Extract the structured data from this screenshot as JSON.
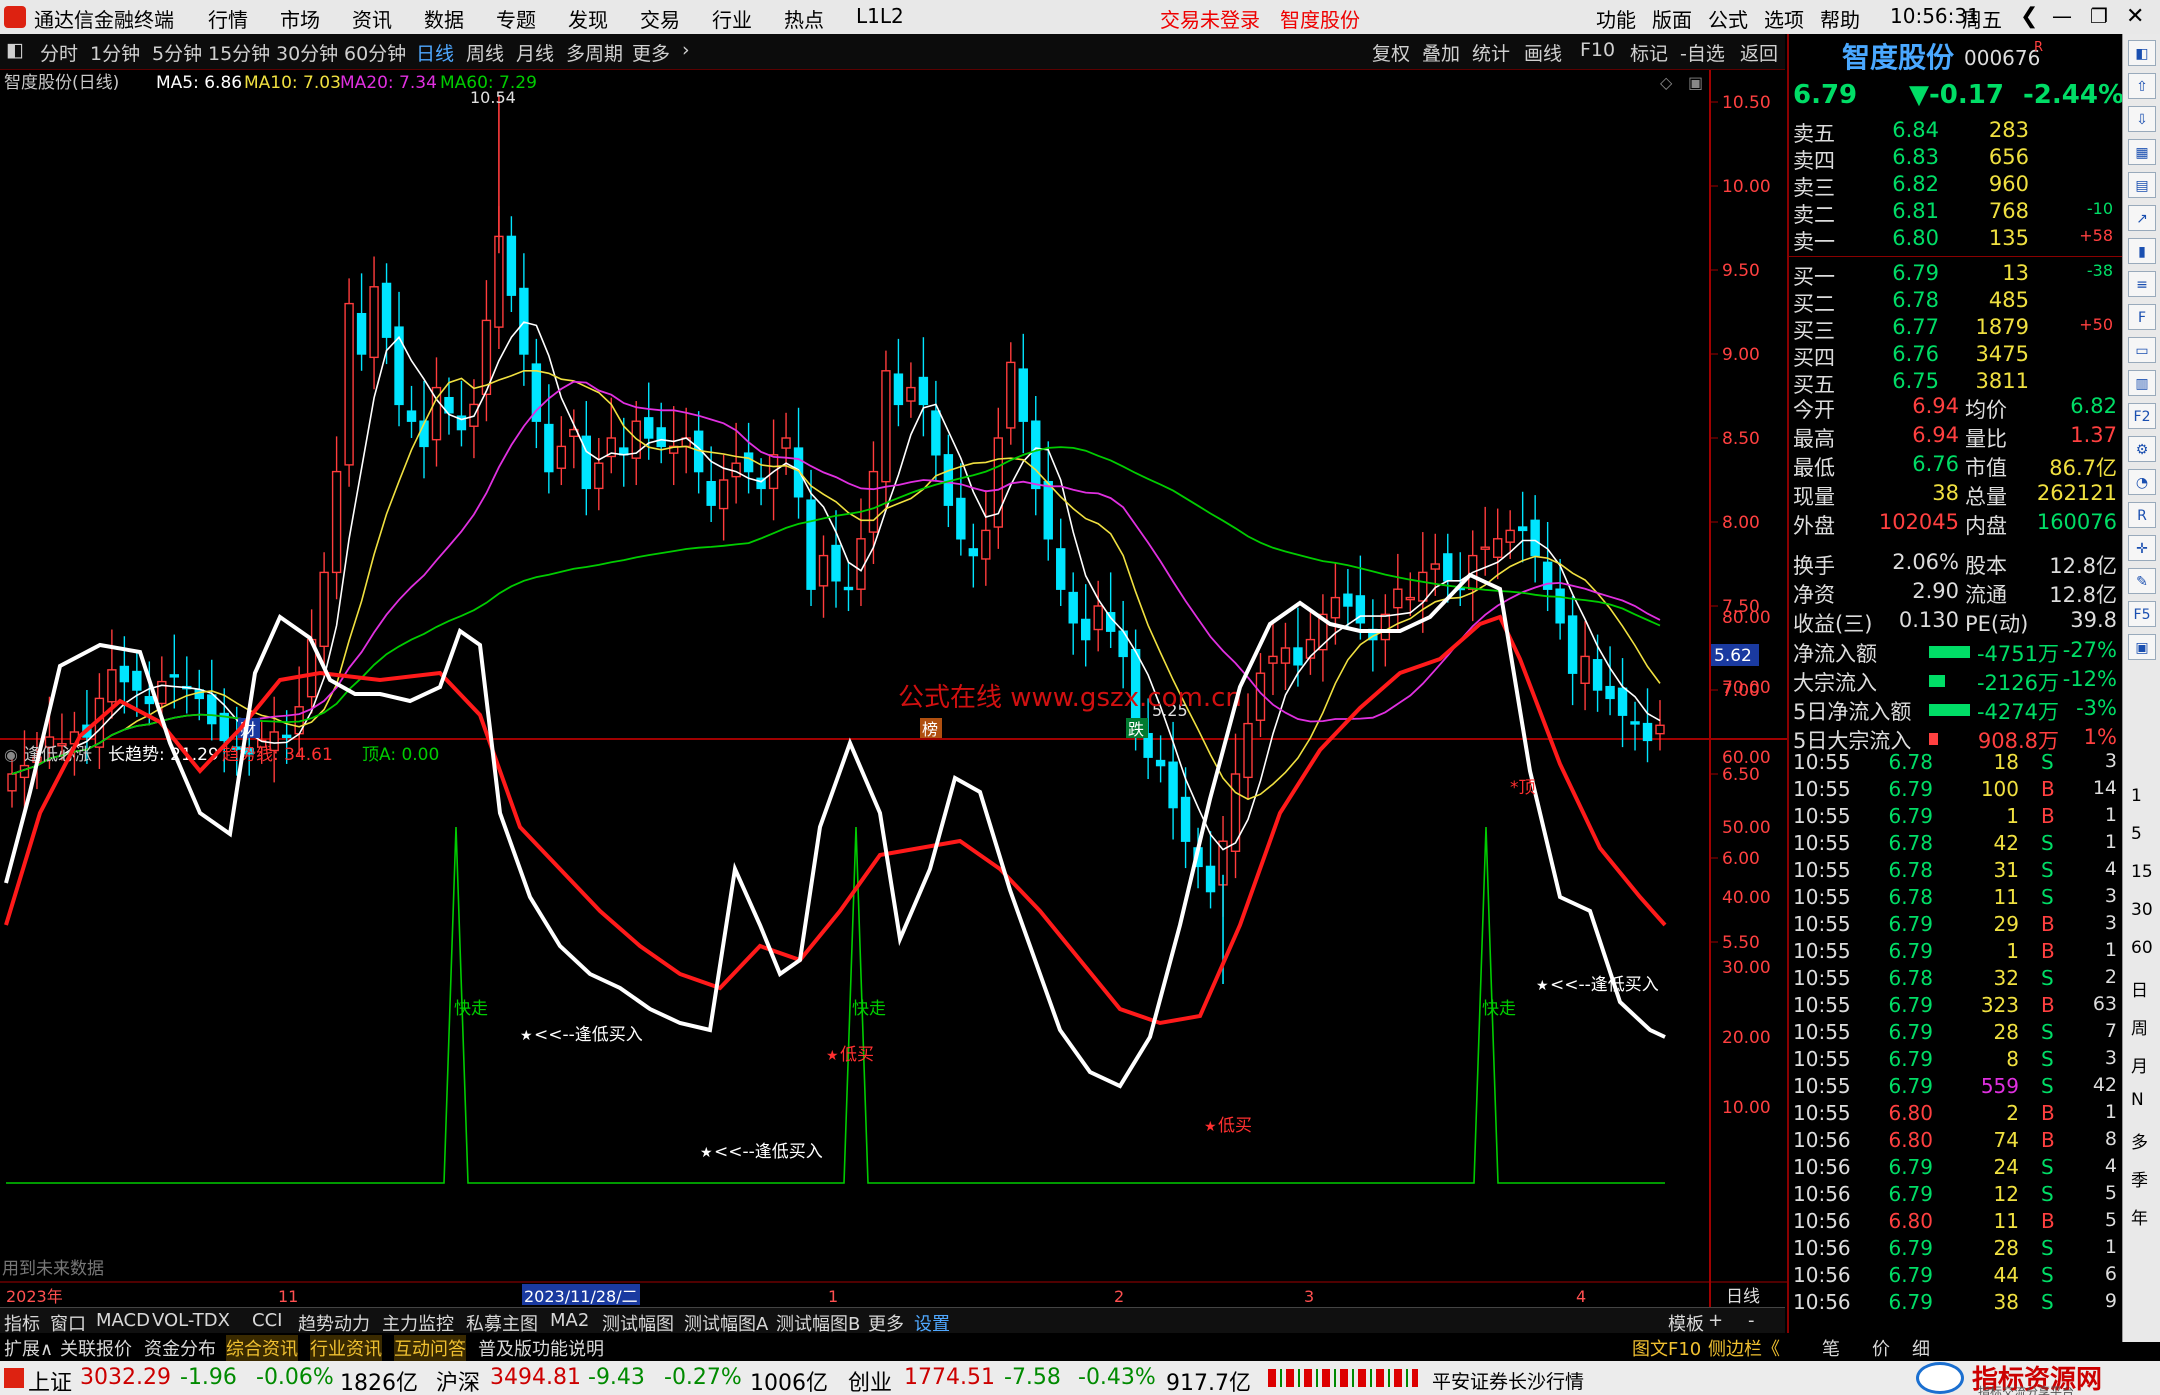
{
  "menubar": {
    "app_title": "通达信金融终端",
    "menus": [
      "行情",
      "市场",
      "资讯",
      "数据",
      "专题",
      "发现",
      "交易",
      "行业",
      "热点",
      "L1L2"
    ],
    "login": "交易未登录",
    "stock_name_top": "智度股份",
    "right_menus": [
      "功能",
      "版面",
      "公式",
      "选项",
      "帮助"
    ],
    "time": "10:56:31",
    "weekday": "周五"
  },
  "toolbar": {
    "periods": [
      "分时",
      "1分钟",
      "5分钟",
      "15分钟",
      "30分钟",
      "60分钟",
      "日线",
      "周线",
      "月线",
      "多周期",
      "更多"
    ],
    "actions": [
      "复权",
      "叠加",
      "统计",
      "画线",
      "F10",
      "标记",
      "-自选",
      "返回"
    ]
  },
  "main_chart": {
    "title": "智度股份(日线)",
    "ma5": "MA5: 6.86",
    "ma10": "MA10: 7.03",
    "ma20": "MA20: 7.34",
    "ma60": "MA60: 7.29",
    "high_label": "10.54",
    "low_label": "5.25",
    "watermark": "公式在线 www.gszx.com.cn",
    "cursor_price": "5.62",
    "y_ticks": [
      "10.50",
      "10.00",
      "9.50",
      "9.00",
      "8.50",
      "8.00",
      "7.50",
      "7.00",
      "6.50",
      "6.00",
      "5.50"
    ],
    "markers": [
      "财",
      "榜",
      "跌"
    ],
    "colors": {
      "up": "#ff3c3c",
      "down": "#00e5ff",
      "ma5": "#ffffff",
      "ma10": "#f0e040",
      "ma20": "#e030e0",
      "ma60": "#00cc00"
    }
  },
  "indicator": {
    "title": "逢低必涨",
    "long_trend": "长趋势: 21.29",
    "trend_line": "趋势线: 34.61",
    "top_a": "顶A: 0.00",
    "y_ticks": [
      "80.00",
      "70.00",
      "60.00",
      "50.00",
      "40.00",
      "30.00",
      "20.00",
      "10.00"
    ],
    "labels": {
      "kuaizou": "快走",
      "buy": "<<--逢低买入",
      "lowbuy": "低买",
      "top": "*顶",
      "future": "用到未来数据"
    }
  },
  "date_axis": {
    "labels": [
      "2023年",
      "11",
      "2023/11/28/二",
      "1",
      "2",
      "3",
      "4"
    ],
    "period": "日线"
  },
  "bottom_tabs": [
    "指标",
    "窗口",
    "MACD",
    "VOL-TDX",
    "CCI",
    "趋势动力",
    "主力监控",
    "私募主图",
    "MA2",
    "测试幅图",
    "测试幅图A",
    "测试幅图B",
    "更多",
    "设置"
  ],
  "bottom_right": [
    "模板",
    "+",
    "-"
  ],
  "bottom_row2": [
    "扩展∧",
    "关联报价",
    "资金分布",
    "综合资讯",
    "行业资讯",
    "互动问答",
    "普及版功能说明"
  ],
  "bottom_row2_right": [
    "图文F10",
    "侧边栏《",
    "笔",
    "价",
    "细"
  ],
  "quote": {
    "name": "智度股份",
    "code": "000676",
    "r_mark": "R",
    "price": "6.79",
    "change": "▼-0.17",
    "pct": "-2.44%",
    "sell": [
      {
        "label": "卖五",
        "price": "6.84",
        "vol": "283",
        "chg": ""
      },
      {
        "label": "卖四",
        "price": "6.83",
        "vol": "656",
        "chg": ""
      },
      {
        "label": "卖三",
        "price": "6.82",
        "vol": "960",
        "chg": ""
      },
      {
        "label": "卖二",
        "price": "6.81",
        "vol": "768",
        "chg": "-10"
      },
      {
        "label": "卖一",
        "price": "6.80",
        "vol": "135",
        "chg": "+58"
      }
    ],
    "buy": [
      {
        "label": "买一",
        "price": "6.79",
        "vol": "13",
        "chg": "-38"
      },
      {
        "label": "买二",
        "price": "6.78",
        "vol": "485",
        "chg": ""
      },
      {
        "label": "买三",
        "price": "6.77",
        "vol": "1879",
        "chg": "+50"
      },
      {
        "label": "买四",
        "price": "6.76",
        "vol": "3475",
        "chg": ""
      },
      {
        "label": "买五",
        "price": "6.75",
        "vol": "3811",
        "chg": ""
      }
    ],
    "stats": [
      [
        "今开",
        "6.94",
        "均价",
        "6.82"
      ],
      [
        "最高",
        "6.94",
        "量比",
        "1.37"
      ],
      [
        "最低",
        "6.76",
        "市值",
        "86.7亿"
      ],
      [
        "现量",
        "38",
        "总量",
        "262121"
      ],
      [
        "外盘",
        "102045",
        "内盘",
        "160076"
      ]
    ],
    "stats2": [
      [
        "换手",
        "2.06%",
        "股本",
        "12.8亿"
      ],
      [
        "净资",
        "2.90",
        "流通",
        "12.8亿"
      ],
      [
        "收益(三)",
        "0.130",
        "PE(动)",
        "39.8"
      ]
    ],
    "flows": [
      [
        "净流入额",
        "-4751万",
        "-27%"
      ],
      [
        "大宗流入",
        "-2126万",
        "-12%"
      ],
      [
        "5日净流入额",
        "-4274万",
        "-3%"
      ],
      [
        "5日大宗流入",
        "908.8万",
        "1%"
      ]
    ],
    "ticks": [
      [
        "10:55",
        "6.78",
        "18",
        "S",
        "3"
      ],
      [
        "10:55",
        "6.79",
        "100",
        "B",
        "14"
      ],
      [
        "10:55",
        "6.79",
        "1",
        "B",
        "1"
      ],
      [
        "10:55",
        "6.78",
        "42",
        "S",
        "1"
      ],
      [
        "10:55",
        "6.78",
        "31",
        "S",
        "4"
      ],
      [
        "10:55",
        "6.78",
        "11",
        "S",
        "3"
      ],
      [
        "10:55",
        "6.79",
        "29",
        "B",
        "3"
      ],
      [
        "10:55",
        "6.79",
        "1",
        "B",
        "1"
      ],
      [
        "10:55",
        "6.78",
        "32",
        "S",
        "2"
      ],
      [
        "10:55",
        "6.79",
        "323",
        "B",
        "63"
      ],
      [
        "10:55",
        "6.79",
        "28",
        "S",
        "7"
      ],
      [
        "10:55",
        "6.79",
        "8",
        "S",
        "3"
      ],
      [
        "10:55",
        "6.79",
        "559",
        "S",
        "42"
      ],
      [
        "10:55",
        "6.80",
        "2",
        "B",
        "1"
      ],
      [
        "10:56",
        "6.80",
        "74",
        "B",
        "8"
      ],
      [
        "10:56",
        "6.79",
        "24",
        "S",
        "4"
      ],
      [
        "10:56",
        "6.79",
        "12",
        "S",
        "5"
      ],
      [
        "10:56",
        "6.80",
        "11",
        "B",
        "5"
      ],
      [
        "10:56",
        "6.79",
        "28",
        "S",
        "1"
      ],
      [
        "10:56",
        "6.79",
        "44",
        "S",
        "6"
      ],
      [
        "10:56",
        "6.79",
        "38",
        "S",
        "9"
      ]
    ]
  },
  "right_strip": [
    "1",
    "5",
    "15",
    "30",
    "60",
    "日",
    "周",
    "月",
    "N",
    "多",
    "季",
    "年"
  ],
  "status": {
    "sh_label": "上证",
    "sh": "3032.29",
    "sh_chg": "-1.96",
    "sh_pct": "-0.06%",
    "sh_amt": "1826亿",
    "sz_label": "沪深",
    "sz": "3494.81",
    "sz_chg": "-9.43",
    "sz_pct": "-0.27%",
    "sz_amt": "1006亿",
    "cy_label": "创业",
    "cy": "1774.51",
    "cy_chg": "-7.58",
    "cy_pct": "-0.43%",
    "cy_amt": "917.7亿",
    "broker": "平安证券长沙行情",
    "site": "指标资源网",
    "site_sub": "指标交流分享平台"
  }
}
